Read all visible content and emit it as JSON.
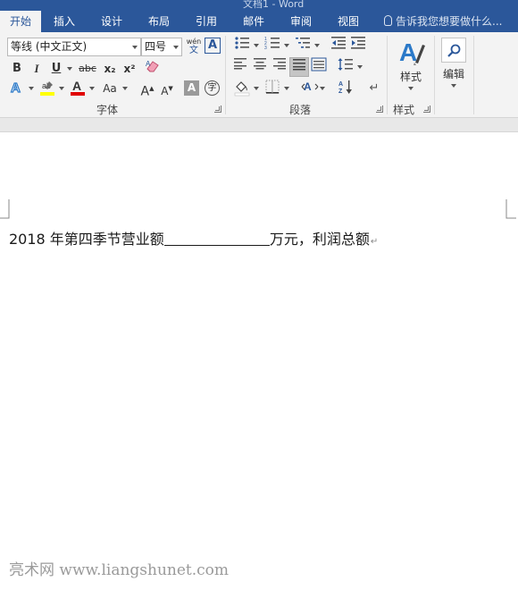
{
  "window": {
    "title_fragment": "文档1 - Word"
  },
  "tabs": [
    {
      "label": "开始",
      "active": true
    },
    {
      "label": "插入"
    },
    {
      "label": "设计"
    },
    {
      "label": "布局"
    },
    {
      "label": "引用"
    },
    {
      "label": "邮件"
    },
    {
      "label": "审阅"
    },
    {
      "label": "视图"
    }
  ],
  "tellme": {
    "text": "告诉我您想要做什么..."
  },
  "font_group": {
    "label": "字体",
    "font_name": "等线 (中文正文)",
    "font_size": "四号",
    "pinyin_label": "wén",
    "pinyin_char": "文",
    "border_char": "A",
    "bold": "B",
    "italic": "I",
    "underline": "U",
    "strike": "abc",
    "subscript": "x₂",
    "superscript": "x²",
    "change_case": "Aa",
    "grow": "A",
    "shrink": "A",
    "shade_char": "A",
    "enclose_char": "字"
  },
  "paragraph_group": {
    "label": "段落"
  },
  "styles_group": {
    "label": "样式",
    "button_label": "样式"
  },
  "editing_group": {
    "button_label": "编辑"
  },
  "document": {
    "before_blank": "2018 年第四季节营业额",
    "after_blank": "万元，利润总额"
  },
  "watermark": "亮术网 www.liangshunet.com",
  "colors": {
    "accent": "#2b579a",
    "highlight": "#ffff00",
    "font_color": "#e00000"
  }
}
